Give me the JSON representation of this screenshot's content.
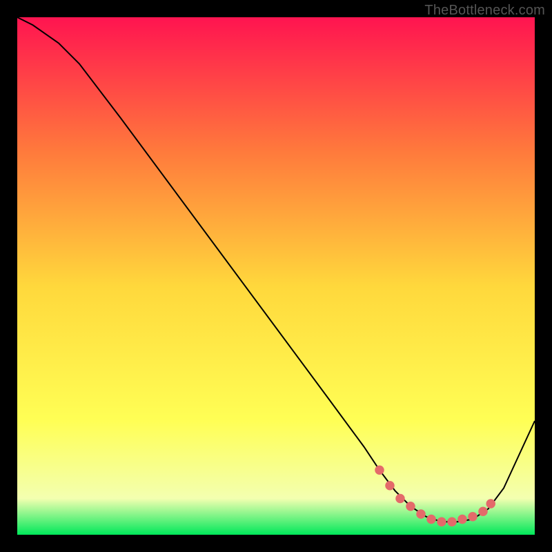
{
  "watermark": "TheBottleneck.com",
  "colors": {
    "page_bg": "#000000",
    "grad_top": "#ff1450",
    "grad_mid_upper": "#ff7a3c",
    "grad_mid": "#ffd83c",
    "grad_mid_lower": "#ffff55",
    "grad_lower": "#f3ffb0",
    "grad_bottom": "#00e85a",
    "curve": "#000000",
    "marker": "#e46a6a"
  },
  "chart_data": {
    "type": "line",
    "title": "",
    "xlabel": "",
    "ylabel": "",
    "xlim": [
      0,
      100
    ],
    "ylim": [
      0,
      100
    ],
    "series": [
      {
        "name": "bottleneck-curve",
        "x": [
          0,
          3,
          8,
          12,
          20,
          30,
          40,
          50,
          60,
          67,
          70,
          73,
          76,
          79,
          82,
          85,
          88,
          91,
          94,
          100
        ],
        "y": [
          100,
          98.5,
          95,
          91,
          80.5,
          67,
          53.5,
          40,
          26.5,
          17,
          12.5,
          8.5,
          5.5,
          3.5,
          2.5,
          2.5,
          3,
          5,
          9,
          22
        ]
      }
    ],
    "markers": {
      "name": "optimal-range",
      "x": [
        70,
        72,
        74,
        76,
        78,
        80,
        82,
        84,
        86,
        88,
        90,
        91.5
      ],
      "y": [
        12.5,
        9.5,
        7,
        5.5,
        4,
        3,
        2.5,
        2.5,
        3,
        3.5,
        4.5,
        6
      ]
    }
  }
}
